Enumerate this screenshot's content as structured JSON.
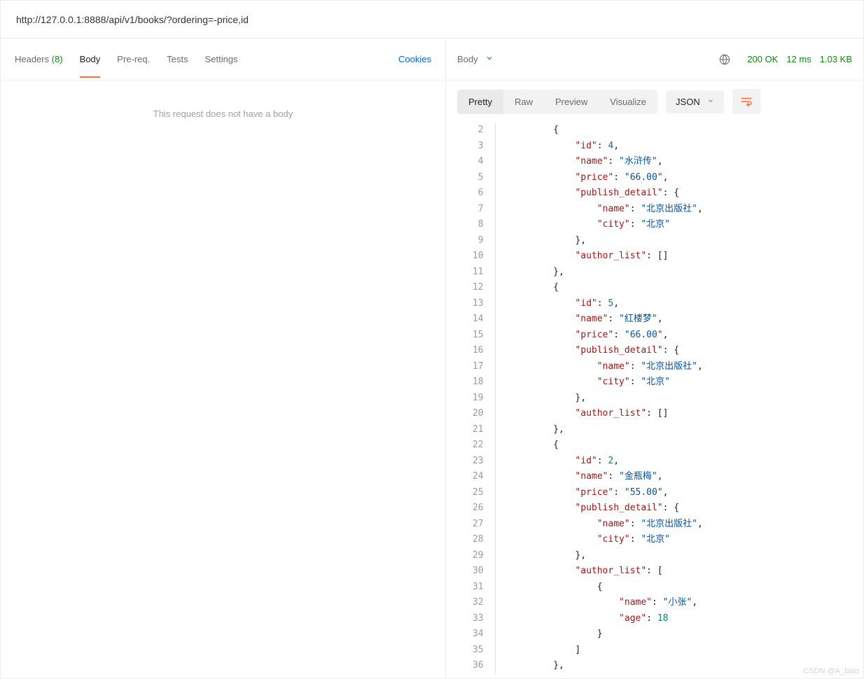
{
  "url": "http://127.0.0.1:8888/api/v1/books/?ordering=-price,id",
  "leftTabs": {
    "headers": "Headers",
    "headersCount": "(8)",
    "body": "Body",
    "prereq": "Pre-req.",
    "tests": "Tests",
    "settings": "Settings",
    "cookies": "Cookies"
  },
  "leftBody": {
    "placeholder": "This request does not have a body"
  },
  "resp": {
    "label": "Body",
    "status": "200 OK",
    "time": "12 ms",
    "size": "1.03 KB"
  },
  "viewTabs": {
    "pretty": "Pretty",
    "raw": "Raw",
    "preview": "Preview",
    "visualize": "Visualize"
  },
  "format": {
    "label": "JSON"
  },
  "codeLines": [
    {
      "n": 2,
      "i": 2,
      "t": [
        {
          "c": "punc",
          "v": "{"
        }
      ]
    },
    {
      "n": 3,
      "i": 3,
      "t": [
        {
          "c": "key",
          "v": "\"id\""
        },
        {
          "c": "punc",
          "v": ": "
        },
        {
          "c": "num",
          "v": "4"
        },
        {
          "c": "punc",
          "v": ","
        }
      ]
    },
    {
      "n": 4,
      "i": 3,
      "t": [
        {
          "c": "key",
          "v": "\"name\""
        },
        {
          "c": "punc",
          "v": ": "
        },
        {
          "c": "str",
          "v": "\"水浒传\""
        },
        {
          "c": "punc",
          "v": ","
        }
      ]
    },
    {
      "n": 5,
      "i": 3,
      "t": [
        {
          "c": "key",
          "v": "\"price\""
        },
        {
          "c": "punc",
          "v": ": "
        },
        {
          "c": "str",
          "v": "\"66.00\""
        },
        {
          "c": "punc",
          "v": ","
        }
      ]
    },
    {
      "n": 6,
      "i": 3,
      "t": [
        {
          "c": "key",
          "v": "\"publish_detail\""
        },
        {
          "c": "punc",
          "v": ": {"
        }
      ]
    },
    {
      "n": 7,
      "i": 4,
      "t": [
        {
          "c": "key",
          "v": "\"name\""
        },
        {
          "c": "punc",
          "v": ": "
        },
        {
          "c": "str",
          "v": "\"北京出版社\""
        },
        {
          "c": "punc",
          "v": ","
        }
      ]
    },
    {
      "n": 8,
      "i": 4,
      "t": [
        {
          "c": "key",
          "v": "\"city\""
        },
        {
          "c": "punc",
          "v": ": "
        },
        {
          "c": "str",
          "v": "\"北京\""
        }
      ]
    },
    {
      "n": 9,
      "i": 3,
      "t": [
        {
          "c": "punc",
          "v": "},"
        }
      ]
    },
    {
      "n": 10,
      "i": 3,
      "t": [
        {
          "c": "key",
          "v": "\"author_list\""
        },
        {
          "c": "punc",
          "v": ": []"
        }
      ]
    },
    {
      "n": 11,
      "i": 2,
      "t": [
        {
          "c": "punc",
          "v": "},"
        }
      ]
    },
    {
      "n": 12,
      "i": 2,
      "t": [
        {
          "c": "punc",
          "v": "{"
        }
      ]
    },
    {
      "n": 13,
      "i": 3,
      "t": [
        {
          "c": "key",
          "v": "\"id\""
        },
        {
          "c": "punc",
          "v": ": "
        },
        {
          "c": "num",
          "v": "5"
        },
        {
          "c": "punc",
          "v": ","
        }
      ]
    },
    {
      "n": 14,
      "i": 3,
      "t": [
        {
          "c": "key",
          "v": "\"name\""
        },
        {
          "c": "punc",
          "v": ": "
        },
        {
          "c": "str",
          "v": "\"红楼梦\""
        },
        {
          "c": "punc",
          "v": ","
        }
      ]
    },
    {
      "n": 15,
      "i": 3,
      "t": [
        {
          "c": "key",
          "v": "\"price\""
        },
        {
          "c": "punc",
          "v": ": "
        },
        {
          "c": "str",
          "v": "\"66.00\""
        },
        {
          "c": "punc",
          "v": ","
        }
      ]
    },
    {
      "n": 16,
      "i": 3,
      "t": [
        {
          "c": "key",
          "v": "\"publish_detail\""
        },
        {
          "c": "punc",
          "v": ": {"
        }
      ]
    },
    {
      "n": 17,
      "i": 4,
      "t": [
        {
          "c": "key",
          "v": "\"name\""
        },
        {
          "c": "punc",
          "v": ": "
        },
        {
          "c": "str",
          "v": "\"北京出版社\""
        },
        {
          "c": "punc",
          "v": ","
        }
      ]
    },
    {
      "n": 18,
      "i": 4,
      "t": [
        {
          "c": "key",
          "v": "\"city\""
        },
        {
          "c": "punc",
          "v": ": "
        },
        {
          "c": "str",
          "v": "\"北京\""
        }
      ]
    },
    {
      "n": 19,
      "i": 3,
      "t": [
        {
          "c": "punc",
          "v": "},"
        }
      ]
    },
    {
      "n": 20,
      "i": 3,
      "t": [
        {
          "c": "key",
          "v": "\"author_list\""
        },
        {
          "c": "punc",
          "v": ": []"
        }
      ]
    },
    {
      "n": 21,
      "i": 2,
      "t": [
        {
          "c": "punc",
          "v": "},"
        }
      ]
    },
    {
      "n": 22,
      "i": 2,
      "t": [
        {
          "c": "punc",
          "v": "{"
        }
      ]
    },
    {
      "n": 23,
      "i": 3,
      "t": [
        {
          "c": "key",
          "v": "\"id\""
        },
        {
          "c": "punc",
          "v": ": "
        },
        {
          "c": "num",
          "v": "2"
        },
        {
          "c": "punc",
          "v": ","
        }
      ]
    },
    {
      "n": 24,
      "i": 3,
      "t": [
        {
          "c": "key",
          "v": "\"name\""
        },
        {
          "c": "punc",
          "v": ": "
        },
        {
          "c": "str",
          "v": "\"金瓶梅\""
        },
        {
          "c": "punc",
          "v": ","
        }
      ]
    },
    {
      "n": 25,
      "i": 3,
      "t": [
        {
          "c": "key",
          "v": "\"price\""
        },
        {
          "c": "punc",
          "v": ": "
        },
        {
          "c": "str",
          "v": "\"55.00\""
        },
        {
          "c": "punc",
          "v": ","
        }
      ]
    },
    {
      "n": 26,
      "i": 3,
      "t": [
        {
          "c": "key",
          "v": "\"publish_detail\""
        },
        {
          "c": "punc",
          "v": ": {"
        }
      ]
    },
    {
      "n": 27,
      "i": 4,
      "t": [
        {
          "c": "key",
          "v": "\"name\""
        },
        {
          "c": "punc",
          "v": ": "
        },
        {
          "c": "str",
          "v": "\"北京出版社\""
        },
        {
          "c": "punc",
          "v": ","
        }
      ]
    },
    {
      "n": 28,
      "i": 4,
      "t": [
        {
          "c": "key",
          "v": "\"city\""
        },
        {
          "c": "punc",
          "v": ": "
        },
        {
          "c": "str",
          "v": "\"北京\""
        }
      ]
    },
    {
      "n": 29,
      "i": 3,
      "t": [
        {
          "c": "punc",
          "v": "},"
        }
      ]
    },
    {
      "n": 30,
      "i": 3,
      "t": [
        {
          "c": "key",
          "v": "\"author_list\""
        },
        {
          "c": "punc",
          "v": ": ["
        }
      ]
    },
    {
      "n": 31,
      "i": 4,
      "t": [
        {
          "c": "punc",
          "v": "{"
        }
      ]
    },
    {
      "n": 32,
      "i": 5,
      "t": [
        {
          "c": "key",
          "v": "\"name\""
        },
        {
          "c": "punc",
          "v": ": "
        },
        {
          "c": "str",
          "v": "\"小张\""
        },
        {
          "c": "punc",
          "v": ","
        }
      ]
    },
    {
      "n": 33,
      "i": 5,
      "t": [
        {
          "c": "key",
          "v": "\"age\""
        },
        {
          "c": "punc",
          "v": ": "
        },
        {
          "c": "num",
          "v": "18"
        }
      ]
    },
    {
      "n": 34,
      "i": 4,
      "t": [
        {
          "c": "punc",
          "v": "}"
        }
      ]
    },
    {
      "n": 35,
      "i": 3,
      "t": [
        {
          "c": "punc",
          "v": "]"
        }
      ]
    },
    {
      "n": 36,
      "i": 2,
      "t": [
        {
          "c": "punc",
          "v": "},"
        }
      ]
    }
  ],
  "watermark": "CSDN @A_baio"
}
